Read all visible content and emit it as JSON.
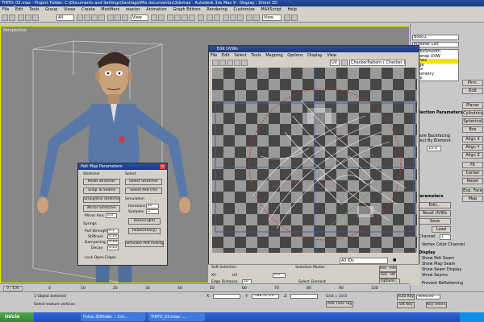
{
  "window": {
    "title": "TIRTO_03.max - Project Folder: C:\\Documents and Settings\\Santiago\\Mis documentos\\3dsmax - Autodesk 3ds Max 9 - Display : Direct 3D"
  },
  "menu": [
    "File",
    "Edit",
    "Tools",
    "Group",
    "Views",
    "Create",
    "Modifiers",
    "reactor",
    "Animation",
    "Graph Editors",
    "Rendering",
    "Customize",
    "MAXScript",
    "Help"
  ],
  "toolbar": {
    "selection_filter": "All",
    "view_dropdown": "View",
    "view_dropdown_2": "View"
  },
  "viewport": {
    "label": "Perspective"
  },
  "command_panel": {
    "object_name": "Box01",
    "modifier_list_label": "Modifier List",
    "stack_items": [
      {
        "label": "TurboSmooth",
        "selected": false
      },
      {
        "label": "Unwrap UVW",
        "selected": false
      },
      {
        "label": "Vertex",
        "selected": true
      },
      {
        "label": "Edge",
        "selected": false
      },
      {
        "label": "Face",
        "selected": false
      },
      {
        "label": "Geometry",
        "selected": false
      },
      {
        "label": "Map",
        "selected": false
      }
    ],
    "section_params": "Selection Parameters",
    "ignore_backfacing": "Ignore Backfacing",
    "select_by_element": "Select By Element",
    "planar_threshold": "15.0",
    "parameters_title": "Parameters",
    "edit_button": "Edit...",
    "reset_uvws": "Reset UVWs",
    "save_button": "Save",
    "load_button": "Load",
    "channel_label": "Channel",
    "map_channel": "1",
    "vertex_color_channel": "Vertex Color Channel",
    "display_title": "Display",
    "show_pelt_seam": "Show Pelt Seam",
    "show_map_seam": "Show Map Seam",
    "show_seam_display": "Show Seam Display",
    "show_seams": "Show Seams",
    "prevent_reflattening": "Prevent Reflattening",
    "right_buttons": [
      "Pinn.",
      "Edit",
      "Planar",
      "Cylindrical",
      "Spherical",
      "Box",
      "Align X",
      "Align Y",
      "Align Z",
      "Fit",
      "Center",
      "Reset",
      "Exp. Face",
      "Map"
    ]
  },
  "uv_editor": {
    "title": "Edit UVWs",
    "menu": [
      "File",
      "Edit",
      "Select",
      "Tools",
      "Mapping",
      "Options",
      "Display",
      "View"
    ],
    "checker_pattern": "CheckerPattern  ( Checker )",
    "uv_mode": "UV",
    "filter_dropdown": "All IDs",
    "soft_selection_title": "Soft Selection",
    "selection_modes_title": "Selection Modes",
    "edge_distance": "Edge Distance",
    "edge_distance_value": "16",
    "falloff_value": "0.0",
    "select_element": "Select Element",
    "rot_label": "Rot. +90",
    "rot_label_2": "Rot. -90",
    "options_button": "Options...",
    "xy_label": "XY",
    "uv_label": "UV"
  },
  "pelt_dialog": {
    "title": "Pelt Map Parameters",
    "stretcher_title": "Stretcher",
    "select_title": "Select",
    "reset_stretcher": "Reset Stretcher",
    "snap_to_seams": "Snap To Seams",
    "straighten_stretcher": "Straighten Stretcher",
    "mirror_stretcher": "Mirror Stretcher",
    "mirror_axis_label": "Mirror Axis",
    "mirror_axis_value": "0.0",
    "select_stretcher": "Select Stretcher",
    "select_pelt_uvs": "Select Pelt UVs",
    "simulation_title": "Simulation",
    "iterations_label": "Iterations",
    "iterations_value": "20",
    "samples_label": "Samples",
    "samples_value": "5",
    "relax_light": "Relax(Light)",
    "relax_heavy": "Relax(Heavy)",
    "springs_title": "Springs",
    "pull_strength_label": "Pull Strength",
    "pull_strength_value": "0.1",
    "stiffness_label": "Stiffness",
    "stiffness_value": "0.16",
    "dampening_label": "Dampening",
    "dampening_value": "0.16",
    "decay_label": "Decay",
    "decay_value": "0.25",
    "simulate_pelt": "Simulate Pelt Pulling",
    "lock_open_edges": "Lock Open Edges"
  },
  "timeline": {
    "frame_display": "0 / 100",
    "ticks": [
      "0",
      "10",
      "20",
      "30",
      "40",
      "50",
      "60",
      "70",
      "80",
      "90",
      "100"
    ]
  },
  "status": {
    "selection": "1 Object Selected",
    "prompt": "Select texture vertices",
    "x_value": "",
    "y_value": "-598.51 cm",
    "z_value": "",
    "grid": "Grid = 10.0",
    "auto_key": "Auto Key",
    "set_key": "Set Key",
    "selected_dropdown": "Selected",
    "key_filters": "Key Filters...",
    "add_time_tag": "Add Time Tag"
  },
  "taskbar": {
    "start": "Inicio",
    "items": [
      "Foros 3DPoder :: Cre...",
      "TIRTO_03.max -..."
    ],
    "clock": ""
  }
}
